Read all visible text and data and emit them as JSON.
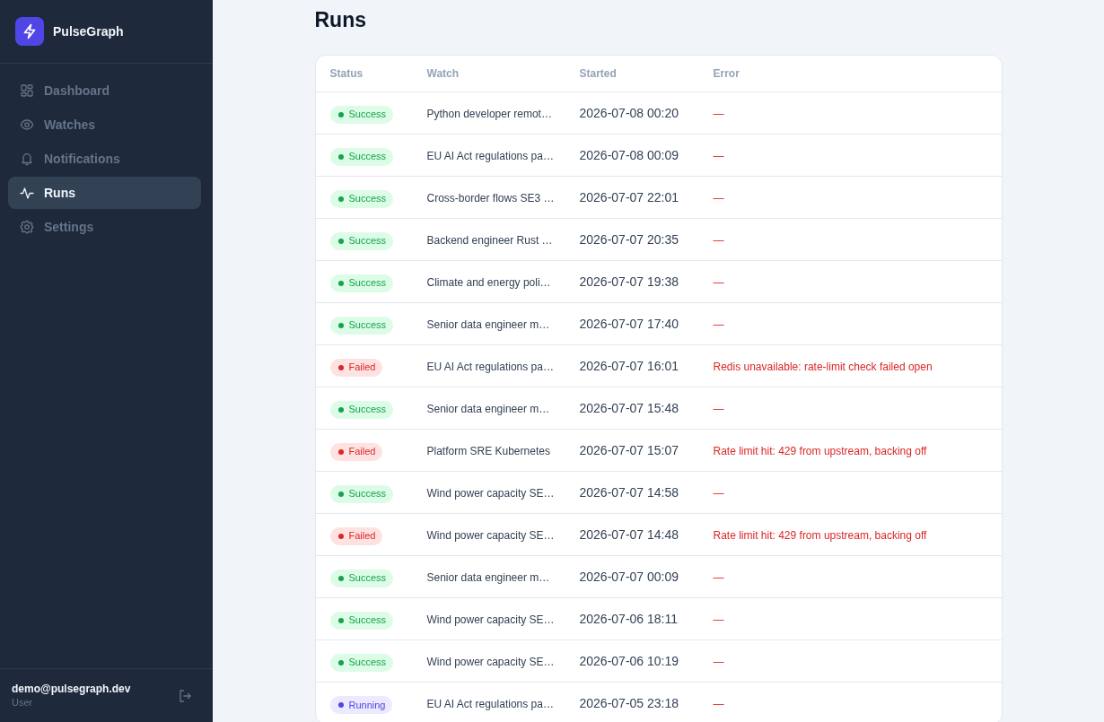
{
  "sidebar": {
    "brand": "PulseGraph",
    "items": [
      {
        "label": "Dashboard",
        "selected": false
      },
      {
        "label": "Watches",
        "selected": false
      },
      {
        "label": "Notifications",
        "selected": false
      },
      {
        "label": "Runs",
        "selected": true
      },
      {
        "label": "Settings",
        "selected": false
      }
    ],
    "user": {
      "email": "demo@pulsegraph.dev",
      "role": "User"
    }
  },
  "page": {
    "title": "Runs"
  },
  "table": {
    "columns": [
      "Status",
      "Watch",
      "Started",
      "Error"
    ],
    "rows": [
      {
        "status": {
          "kind": "success",
          "label": "Success"
        },
        "watch": "Python developer remot…",
        "started": "2026-07-08 00:20",
        "error": "—"
      },
      {
        "status": {
          "kind": "success",
          "label": "Success"
        },
        "watch": "EU AI Act regulations pa…",
        "started": "2026-07-08 00:09",
        "error": "—"
      },
      {
        "status": {
          "kind": "success",
          "label": "Success"
        },
        "watch": "Cross-border flows SE3 …",
        "started": "2026-07-07 22:01",
        "error": "—"
      },
      {
        "status": {
          "kind": "success",
          "label": "Success"
        },
        "watch": "Backend engineer Rust …",
        "started": "2026-07-07 20:35",
        "error": "—"
      },
      {
        "status": {
          "kind": "success",
          "label": "Success"
        },
        "watch": "Climate and energy poli…",
        "started": "2026-07-07 19:38",
        "error": "—"
      },
      {
        "status": {
          "kind": "success",
          "label": "Success"
        },
        "watch": "Senior data engineer m…",
        "started": "2026-07-07 17:40",
        "error": "—"
      },
      {
        "status": {
          "kind": "failed",
          "label": "Failed"
        },
        "watch": "EU AI Act regulations pa…",
        "started": "2026-07-07 16:01",
        "error": "Redis unavailable: rate-limit check failed open"
      },
      {
        "status": {
          "kind": "success",
          "label": "Success"
        },
        "watch": "Senior data engineer m…",
        "started": "2026-07-07 15:48",
        "error": "—"
      },
      {
        "status": {
          "kind": "failed",
          "label": "Failed"
        },
        "watch": "Platform SRE Kubernetes",
        "started": "2026-07-07 15:07",
        "error": "Rate limit hit: 429 from upstream, backing off"
      },
      {
        "status": {
          "kind": "success",
          "label": "Success"
        },
        "watch": "Wind power capacity SE…",
        "started": "2026-07-07 14:58",
        "error": "—"
      },
      {
        "status": {
          "kind": "failed",
          "label": "Failed"
        },
        "watch": "Wind power capacity SE…",
        "started": "2026-07-07 14:48",
        "error": "Rate limit hit: 429 from upstream, backing off"
      },
      {
        "status": {
          "kind": "success",
          "label": "Success"
        },
        "watch": "Senior data engineer m…",
        "started": "2026-07-07 00:09",
        "error": "—"
      },
      {
        "status": {
          "kind": "success",
          "label": "Success"
        },
        "watch": "Wind power capacity SE…",
        "started": "2026-07-06 18:11",
        "error": "—"
      },
      {
        "status": {
          "kind": "success",
          "label": "Success"
        },
        "watch": "Wind power capacity SE…",
        "started": "2026-07-06 10:19",
        "error": "—"
      },
      {
        "status": {
          "kind": "running",
          "label": "Running"
        },
        "watch": "EU AI Act regulations pa…",
        "started": "2026-07-05 23:18",
        "error": "—"
      }
    ]
  }
}
